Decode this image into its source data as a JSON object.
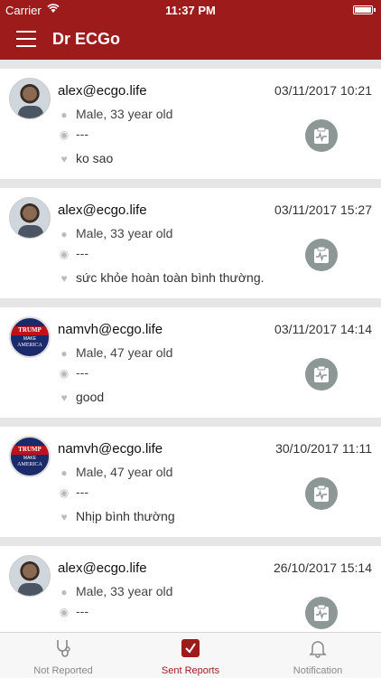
{
  "status_bar": {
    "carrier": "Carrier",
    "time": "11:37 PM"
  },
  "nav": {
    "title": "Dr ECGo"
  },
  "reports": [
    {
      "avatar": "person",
      "email": "alex@ecgo.life",
      "date": "03/11/2017 10:21",
      "gender_age": "Male, 33 year old",
      "location": "---",
      "note": "ko sao"
    },
    {
      "avatar": "person",
      "email": "alex@ecgo.life",
      "date": "03/11/2017 15:27",
      "gender_age": "Male, 33 year old",
      "location": "---",
      "note": "sức khỏe hoàn toàn bình thường."
    },
    {
      "avatar": "trump",
      "email": "namvh@ecgo.life",
      "date": "03/11/2017 14:14",
      "gender_age": "Male, 47 year old",
      "location": "---",
      "note": "good"
    },
    {
      "avatar": "trump",
      "email": "namvh@ecgo.life",
      "date": "30/10/2017 11:11",
      "gender_age": "Male, 47 year old",
      "location": "---",
      "note": "Nhịp bình thường"
    },
    {
      "avatar": "person",
      "email": "alex@ecgo.life",
      "date": "26/10/2017 15:14",
      "gender_age": "Male, 33 year old",
      "location": "---",
      "note": ""
    }
  ],
  "trump_badge": {
    "line1": "TRUMP",
    "line2": "MAKE",
    "line3": "AMERICA"
  },
  "tabs": [
    {
      "label": "Not Reported",
      "icon": "stethoscope-icon"
    },
    {
      "label": "Sent Reports",
      "icon": "checkbox-icon",
      "active": true
    },
    {
      "label": "Notification",
      "icon": "bell-icon"
    }
  ],
  "colors": {
    "brand": "#9e1b1b",
    "report_button": "#8d9796"
  }
}
